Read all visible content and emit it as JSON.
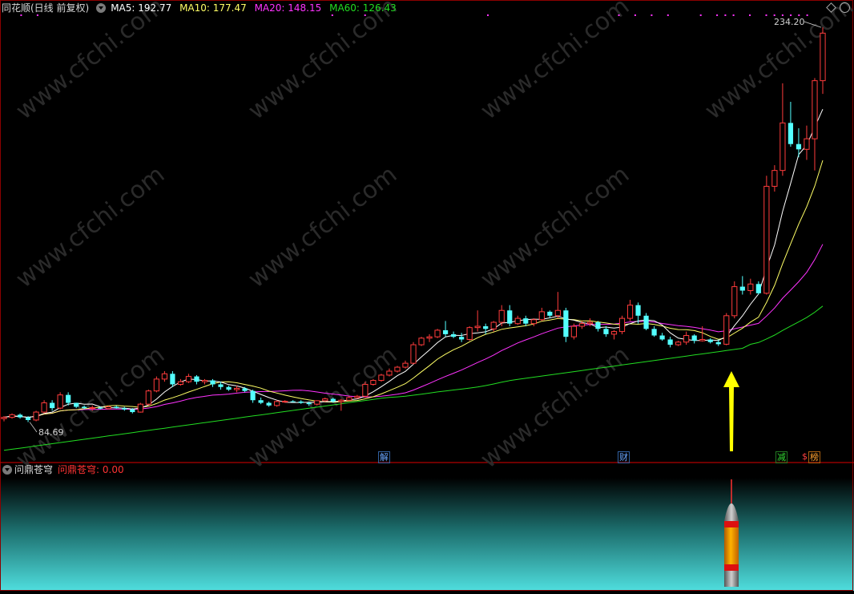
{
  "header": {
    "title": "同花顺(日线 前复权)",
    "ma5_label": "MA5: 192.77",
    "ma10_label": "MA10: 177.47",
    "ma20_label": "MA20: 148.15",
    "ma60_label": "MA60: 126.43"
  },
  "sub_panel": {
    "title": "问鼎苍穹",
    "value_label": "问鼎苍穹: 0.00"
  },
  "markers": {
    "jie": "解",
    "cai": "财",
    "jian": "减",
    "dollar": "$",
    "bang": "榜"
  },
  "watermark": "www.cfchi.com",
  "colors": {
    "up": "#ff3c3c",
    "down": "#54ffff",
    "ma5": "#ffffff",
    "ma10": "#ffff66",
    "ma20": "#ff33ff",
    "ma60": "#22dd22",
    "arrow": "#ffff00"
  },
  "chart_data": {
    "type": "candlestick",
    "price_range": [
      70,
      240
    ],
    "max_label": "234.20",
    "min_label": "84.69",
    "candles": [
      [
        86,
        87,
        85,
        86.5
      ],
      [
        86.5,
        88,
        86,
        87.5
      ],
      [
        87.5,
        88,
        86,
        86.5
      ],
      [
        86.5,
        87,
        84.7,
        85.5
      ],
      [
        85.5,
        89,
        85,
        88.5
      ],
      [
        88.5,
        93,
        88,
        92
      ],
      [
        92,
        93,
        89,
        90
      ],
      [
        90,
        96,
        89.5,
        95
      ],
      [
        95,
        96,
        91,
        92
      ],
      [
        92,
        92,
        90,
        90.5
      ],
      [
        90.5,
        91,
        89.5,
        90
      ],
      [
        90,
        91,
        89,
        90.2
      ],
      [
        90.2,
        90.5,
        89.5,
        89.8
      ],
      [
        89.8,
        91,
        89.5,
        90.5
      ],
      [
        90.5,
        91,
        89.8,
        90
      ],
      [
        90,
        90.5,
        89,
        89.5
      ],
      [
        89.5,
        90,
        88,
        88.5
      ],
      [
        88.5,
        92,
        88.3,
        91.5
      ],
      [
        91.5,
        97,
        91,
        96.5
      ],
      [
        96.5,
        102,
        96,
        101
      ],
      [
        101,
        104,
        100,
        103
      ],
      [
        103,
        104,
        98,
        99
      ],
      [
        99,
        101,
        98.5,
        100
      ],
      [
        100,
        103,
        99.5,
        102
      ],
      [
        102,
        102.5,
        99,
        100
      ],
      [
        100,
        101,
        99,
        100.5
      ],
      [
        100.5,
        101,
        98,
        99
      ],
      [
        99,
        100,
        97,
        98
      ],
      [
        98,
        98.5,
        96.5,
        97
      ],
      [
        97,
        98.5,
        96,
        97.5
      ],
      [
        97.5,
        98,
        96,
        96.5
      ],
      [
        96.5,
        97,
        92,
        93
      ],
      [
        93,
        94,
        91.5,
        92
      ],
      [
        92,
        92.5,
        90.5,
        91
      ],
      [
        91,
        93,
        90.5,
        92.5
      ],
      [
        92.5,
        93,
        92,
        92.6
      ],
      [
        92.6,
        93,
        92.2,
        92.5
      ],
      [
        92.5,
        93,
        91.6,
        92
      ],
      [
        92,
        92.5,
        90.8,
        91.5
      ],
      [
        91.5,
        93,
        91,
        92.8
      ],
      [
        92.8,
        94,
        92.4,
        93.5
      ],
      [
        93.5,
        94,
        92,
        92.5
      ],
      [
        92.5,
        93.5,
        89,
        93
      ],
      [
        93,
        94.5,
        92.8,
        94
      ],
      [
        94,
        95,
        93.5,
        94.5
      ],
      [
        94.5,
        100,
        94,
        99
      ],
      [
        99,
        101,
        98.5,
        100.5
      ],
      [
        100.5,
        103,
        100,
        102.5
      ],
      [
        102.5,
        105,
        102,
        104
      ],
      [
        104,
        106,
        103.5,
        105.5
      ],
      [
        105.5,
        108,
        105,
        107
      ],
      [
        107,
        115,
        106.5,
        114
      ],
      [
        114,
        117,
        113.5,
        116.5
      ],
      [
        116.5,
        118,
        115,
        117
      ],
      [
        117,
        120,
        116.5,
        119.5
      ],
      [
        119.5,
        123,
        117,
        118
      ],
      [
        118,
        119,
        116.5,
        117
      ],
      [
        117,
        118.5,
        115,
        116
      ],
      [
        116,
        121,
        115.5,
        120.5
      ],
      [
        120.5,
        127,
        119,
        121
      ],
      [
        121,
        122,
        118,
        120
      ],
      [
        120,
        123,
        119,
        122.5
      ],
      [
        122.5,
        129,
        121,
        127
      ],
      [
        127,
        129,
        121,
        122
      ],
      [
        122,
        125,
        121.5,
        124
      ],
      [
        124,
        125,
        121,
        122
      ],
      [
        122,
        124,
        121,
        123.5
      ],
      [
        123.5,
        128,
        123,
        126.5
      ],
      [
        126.5,
        127,
        124,
        125
      ],
      [
        125,
        134,
        124,
        127
      ],
      [
        127,
        128,
        115,
        117
      ],
      [
        117,
        122,
        116,
        121
      ],
      [
        121,
        123,
        120,
        122
      ],
      [
        122,
        124,
        121,
        122.5
      ],
      [
        122.5,
        123,
        119,
        120
      ],
      [
        120,
        121,
        117,
        118
      ],
      [
        118,
        119.5,
        116,
        119
      ],
      [
        119,
        125,
        118,
        124
      ],
      [
        124,
        131,
        123,
        129
      ],
      [
        129,
        130,
        122,
        125
      ],
      [
        125,
        126,
        119.5,
        120
      ],
      [
        120,
        121,
        117,
        117.5
      ],
      [
        117.5,
        118.5,
        115.5,
        116
      ],
      [
        116,
        117,
        113,
        114
      ],
      [
        114,
        115.5,
        113.5,
        115
      ],
      [
        115,
        119,
        114,
        117.5
      ],
      [
        117.5,
        118,
        114.5,
        115.5
      ],
      [
        115.5,
        121,
        115.2,
        116
      ],
      [
        116,
        116.5,
        114.5,
        115
      ],
      [
        115,
        116,
        113.5,
        114.2
      ],
      [
        114.2,
        126,
        113.8,
        125
      ],
      [
        125,
        138,
        124,
        136
      ],
      [
        136,
        140,
        133,
        134.5
      ],
      [
        134.5,
        139,
        133,
        137
      ],
      [
        137,
        138,
        133,
        133.5
      ],
      [
        133.5,
        178,
        133,
        174
      ],
      [
        174,
        182,
        172,
        180
      ],
      [
        180,
        213,
        178,
        198
      ],
      [
        198,
        206,
        189,
        190
      ],
      [
        190,
        196,
        185,
        188
      ],
      [
        188,
        197,
        184,
        192
      ],
      [
        192,
        215,
        180,
        214
      ],
      [
        214,
        234.2,
        209,
        232
      ]
    ]
  }
}
